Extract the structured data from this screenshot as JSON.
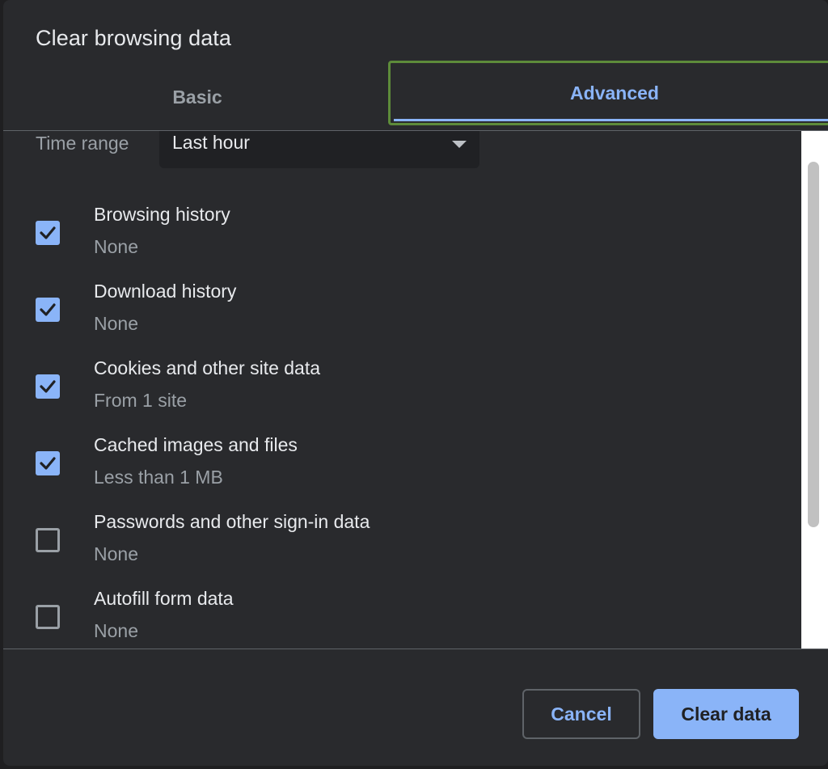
{
  "dialog": {
    "title": "Clear browsing data"
  },
  "tabs": {
    "basic": "Basic",
    "advanced": "Advanced",
    "active": "advanced"
  },
  "time_range": {
    "label": "Time range",
    "value": "Last hour"
  },
  "items": [
    {
      "label": "Browsing history",
      "detail": "None",
      "checked": true
    },
    {
      "label": "Download history",
      "detail": "None",
      "checked": true
    },
    {
      "label": "Cookies and other site data",
      "detail": "From 1 site",
      "checked": true
    },
    {
      "label": "Cached images and files",
      "detail": "Less than 1 MB",
      "checked": true
    },
    {
      "label": "Passwords and other sign-in data",
      "detail": "None",
      "checked": false
    },
    {
      "label": "Autofill form data",
      "detail": "None",
      "checked": false
    }
  ],
  "buttons": {
    "cancel": "Cancel",
    "clear": "Clear data"
  },
  "colors": {
    "background": "#292a2d",
    "accent": "#8ab4f8",
    "text": "#e8eaed",
    "secondary_text": "#9aa0a6",
    "focus_ring": "#5d8b3a"
  },
  "icons": {
    "dropdown": "chevron-down-icon",
    "checkmark": "checkmark-icon"
  }
}
